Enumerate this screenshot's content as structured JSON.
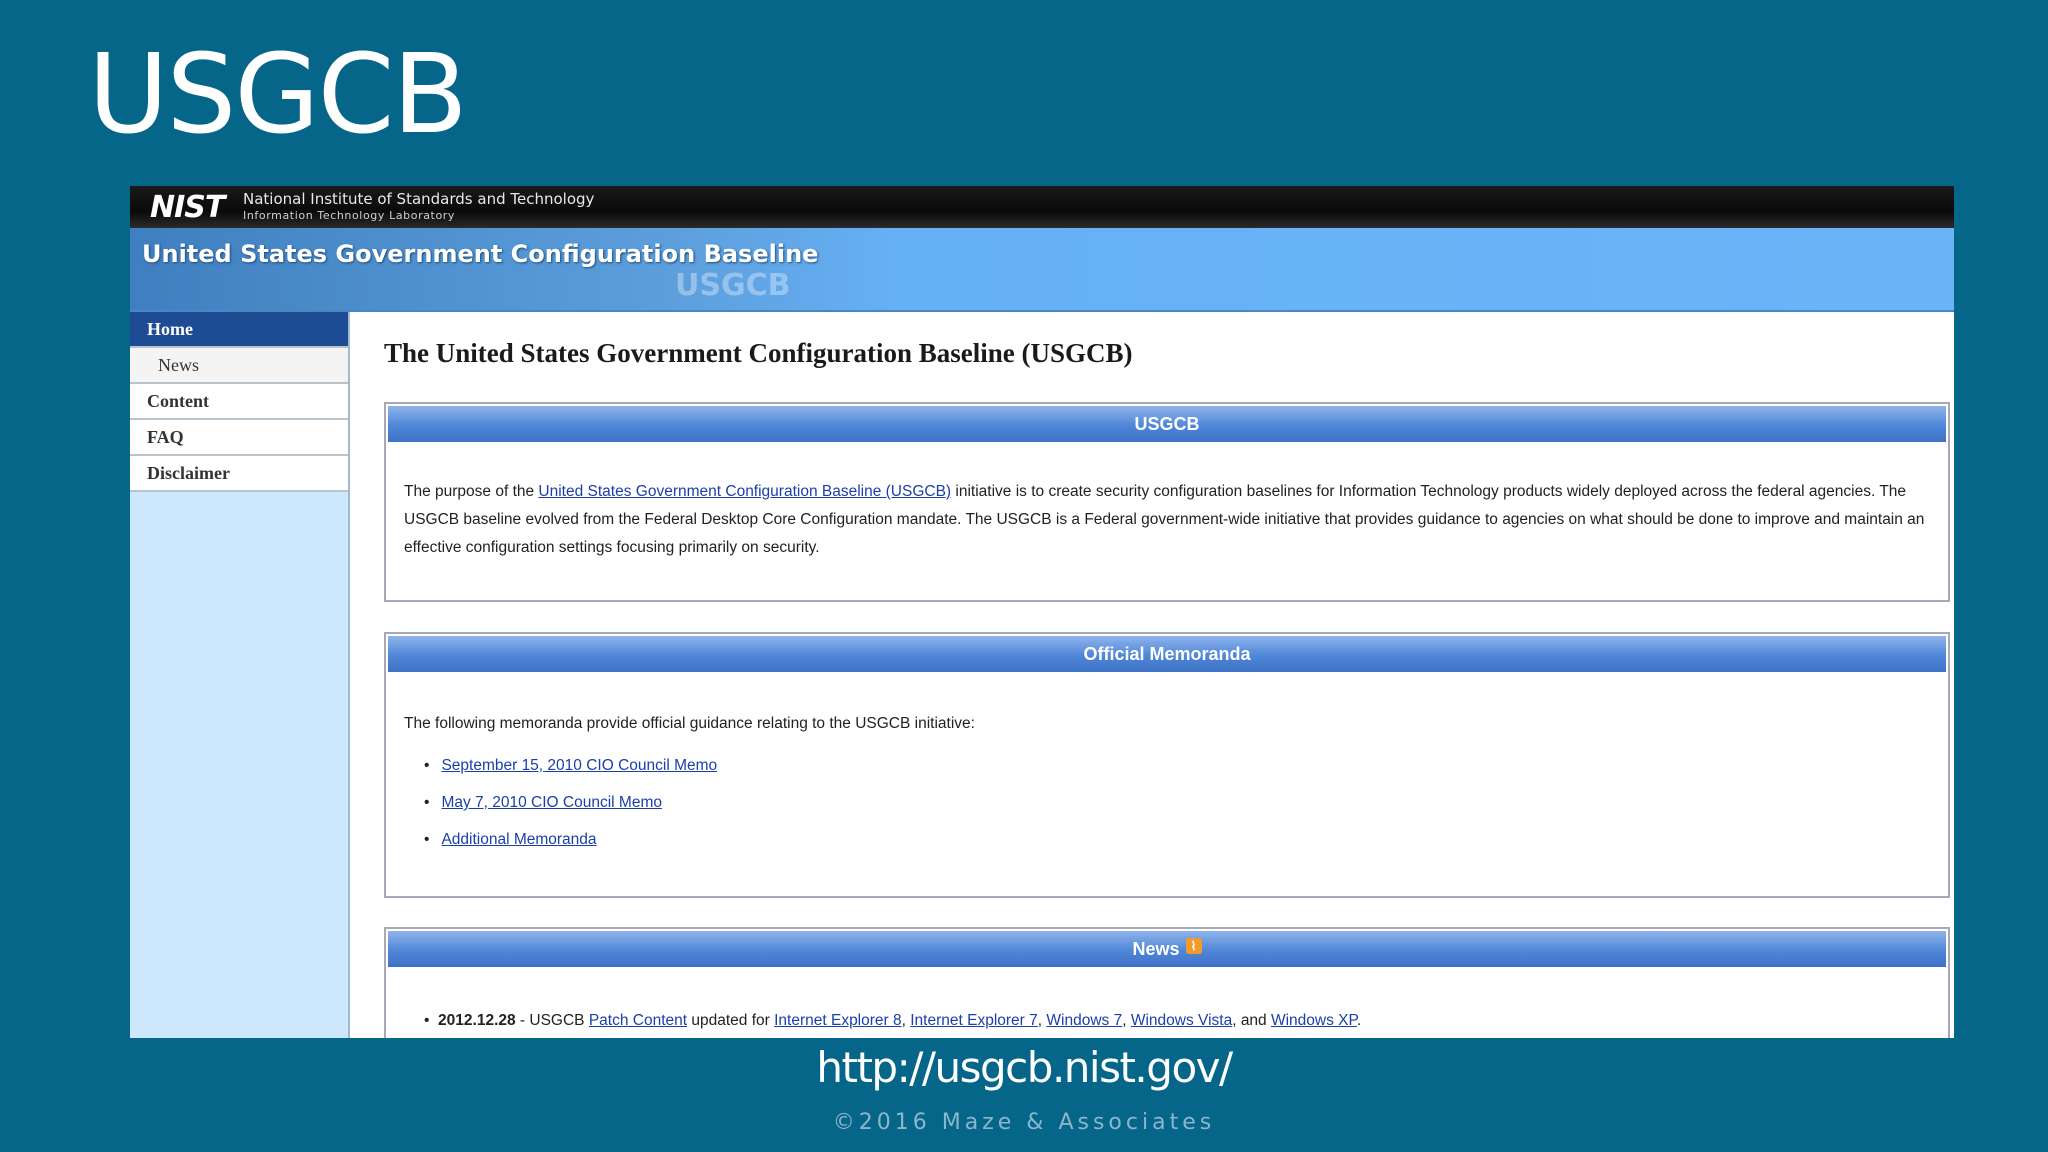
{
  "slide": {
    "title": "USGCB",
    "url": "http://usgcb.nist.gov/",
    "copyright": "©2016 Maze & Associates"
  },
  "site": {
    "nist_logo": "NIST",
    "nist_name": "National Institute of Standards and Technology",
    "nist_lab": "Information Technology Laboratory",
    "banner_title": "United States Government Configuration Baseline",
    "banner_watermark": "USGCB"
  },
  "nav": {
    "items": [
      {
        "label": "Home",
        "active": true
      },
      {
        "label": "News"
      },
      {
        "label": "Content"
      },
      {
        "label": "FAQ"
      },
      {
        "label": "Disclaimer"
      }
    ]
  },
  "main": {
    "heading": "The United States Government Configuration Baseline (USGCB)",
    "usgcb_box": {
      "header": "USGCB",
      "text_before": "The purpose of the ",
      "link": "United States Government Configuration Baseline (USGCB)",
      "text_after": " initiative is to create security configuration baselines for Information Technology products widely deployed across the federal agencies. The USGCB baseline evolved from the Federal Desktop Core Configuration mandate. The USGCB is a Federal government-wide initiative that provides guidance to agencies on what should be done to improve and maintain an effective configuration settings focusing primarily on security."
    },
    "memo_box": {
      "header": "Official Memoranda",
      "intro": "The following memoranda provide official guidance relating to the USGCB initiative:",
      "links": [
        "September 15, 2010 CIO Council Memo",
        "May 7, 2010 CIO Council Memo",
        "Additional Memoranda"
      ]
    },
    "news_box": {
      "header": "News",
      "item": {
        "date": "2012.12.28",
        "t1": " - USGCB ",
        "l1": "Patch Content",
        "t2": " updated for ",
        "l2": "Internet Explorer 8",
        "t3": ", ",
        "l3": "Internet Explorer 7",
        "t4": ", ",
        "l4": "Windows 7",
        "t5": ", ",
        "l5": "Windows Vista",
        "t6": ", and ",
        "l6": "Windows XP",
        "t7": "."
      }
    }
  }
}
